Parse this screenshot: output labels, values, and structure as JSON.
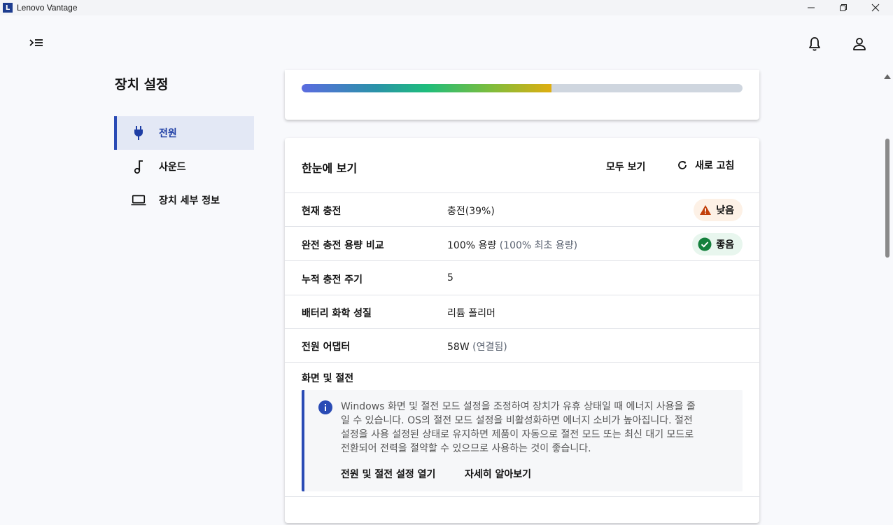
{
  "window": {
    "app_logo": "L",
    "title": "Lenovo Vantage"
  },
  "sidebar": {
    "title": "장치 설정",
    "items": [
      {
        "label": "전원",
        "icon": "plug-icon",
        "active": true
      },
      {
        "label": "사운드",
        "icon": "music-note-icon",
        "active": false
      },
      {
        "label": "장치 세부 정보",
        "icon": "laptop-icon",
        "active": false
      }
    ]
  },
  "battery_bar": {
    "fill_percent": 56.7
  },
  "glance": {
    "title": "한눈에 보기",
    "view_all": "모두 보기",
    "refresh": "새로 고침",
    "rows": [
      {
        "label": "현재 충전",
        "value": "충전(39%)",
        "note": "",
        "badge": "낮음"
      },
      {
        "label": "완전 충전 용량 비교",
        "value": "100% 용량",
        "note": "(100% 최초 용량)",
        "badge": "좋음"
      },
      {
        "label": "누적 충전 주기",
        "value": "5",
        "note": ""
      },
      {
        "label": "배터리 화학 성질",
        "value": "리튬 폴리머",
        "note": ""
      },
      {
        "label": "전원 어댑터",
        "value": "58W",
        "note": "(연결됨)"
      }
    ]
  },
  "sleep": {
    "title": "화면 및 절전",
    "info_lines": [
      "Windows 화면 및 절전 모드 설정을 조정하여 장치가 유휴 상태일 때 에너지 사용을 줄",
      "일 수 있습니다. OS의 절전 모드 설정을 비활성화하면 에너지 소비가 높아집니다. 절전",
      "설정을 사용 설정된 상태로 유지하면 제품이 자동으로 절전 모드 또는 최신 대기 모드로",
      "전환되어 전력을 절약할 수 있으므로 사용하는 것이 좋습니다."
    ],
    "link_open": "전원 및 절전 설정 열기",
    "link_learn": "자세히 알아보기"
  },
  "colors": {
    "accent": "#2a4bb5",
    "warning": "#c2410c",
    "success": "#15803d"
  }
}
